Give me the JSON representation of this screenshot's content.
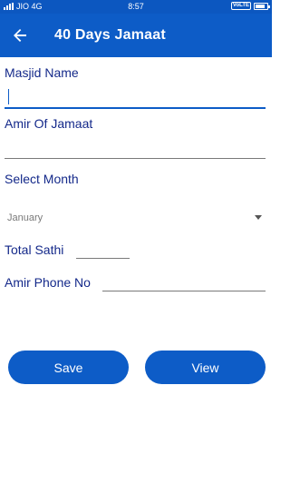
{
  "status_bar": {
    "carrier": "JIO 4G",
    "time": "8:57",
    "volte": "VoLTE"
  },
  "toolbar": {
    "title": "40 Days Jamaat",
    "back_icon": "arrow-left-icon"
  },
  "form": {
    "masjid_name_label": "Masjid Name",
    "masjid_name_value": "",
    "amir_label": "Amir Of Jamaat",
    "amir_value": "",
    "month_label": "Select Month",
    "month_selected": "January",
    "total_sathi_label": "Total Sathi",
    "total_sathi_value": "",
    "phone_label": "Amir Phone No",
    "phone_value": ""
  },
  "buttons": {
    "save_label": "Save",
    "view_label": "View"
  },
  "colors": {
    "primary": "#0d5cc7",
    "status_bar": "#0c57c0",
    "label_text": "#14298a"
  }
}
